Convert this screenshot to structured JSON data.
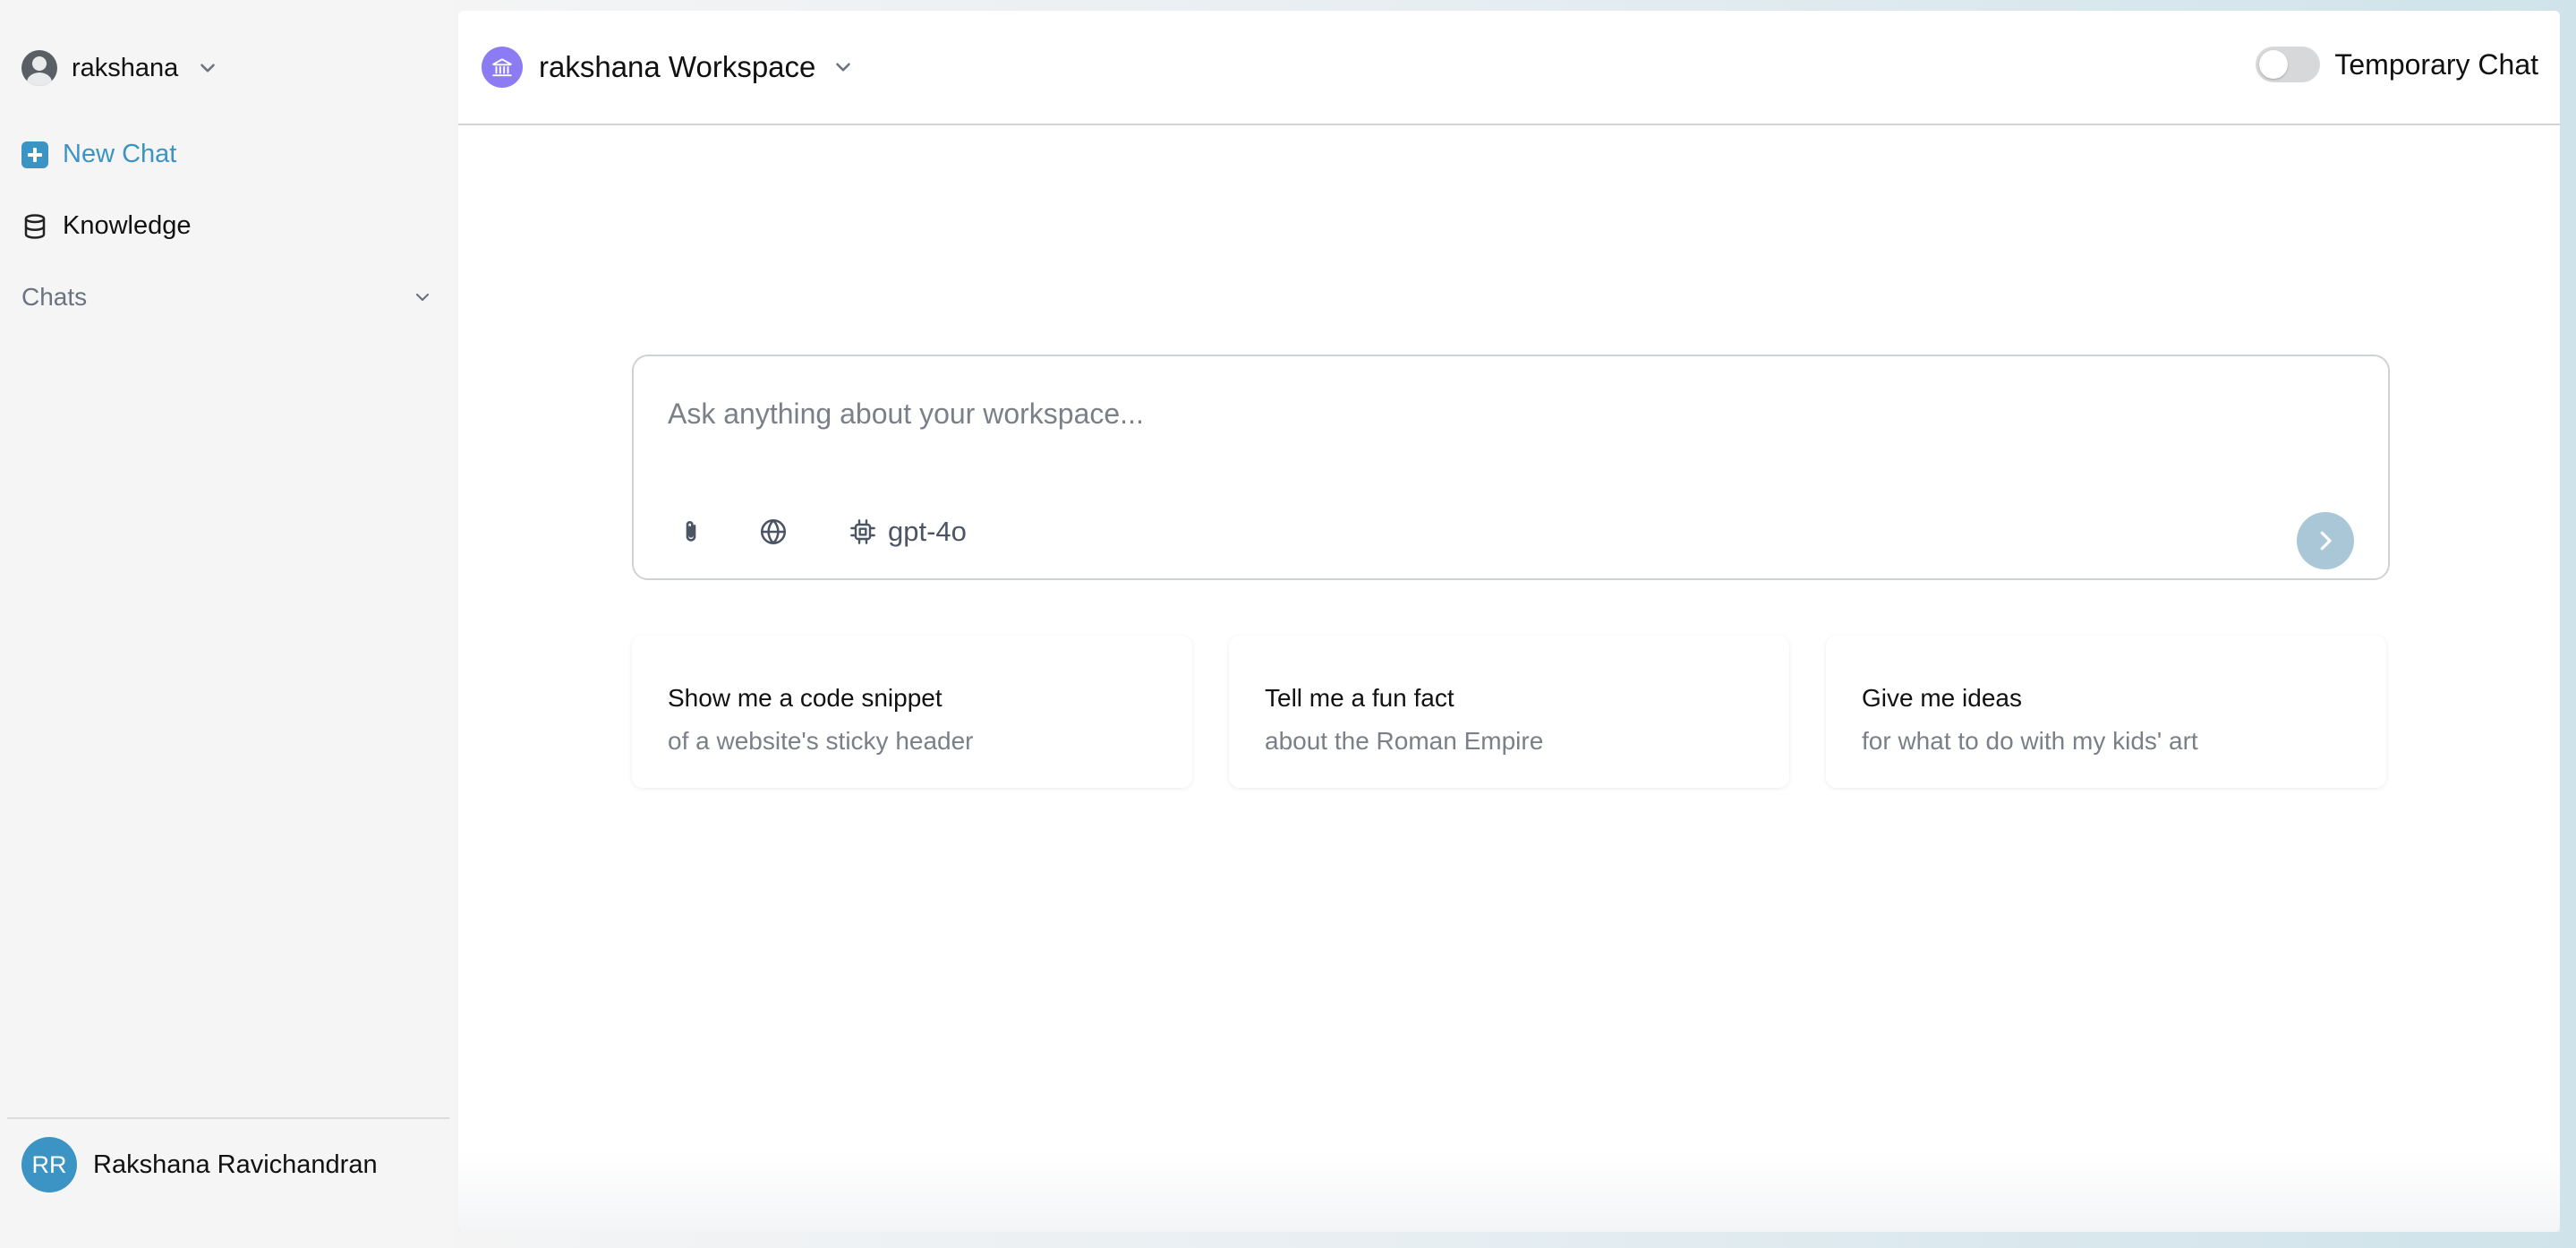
{
  "sidebar": {
    "user": {
      "name": "rakshana"
    },
    "new_chat": "New Chat",
    "knowledge": "Knowledge",
    "chats_label": "Chats",
    "profile": {
      "initials": "RR",
      "name": "Rakshana Ravichandran"
    }
  },
  "header": {
    "workspace_title": "rakshana Workspace",
    "temporary_chat_label": "Temporary Chat",
    "temporary_chat_enabled": false
  },
  "composer": {
    "placeholder": "Ask anything about your workspace...",
    "value": "",
    "model": "gpt-4o"
  },
  "suggestions": [
    {
      "title": "Show me a code snippet",
      "subtitle": "of a website's sticky header"
    },
    {
      "title": "Tell me a fun fact",
      "subtitle": "about the Roman Empire"
    },
    {
      "title": "Give me ideas",
      "subtitle": "for what to do with my kids' art"
    }
  ],
  "colors": {
    "accent": "#3b94c4",
    "workspace_icon": "#8b7cf3",
    "send_button": "#a9c7d6",
    "sidebar_bg": "#f5f5f5"
  },
  "icons": {
    "user_avatar": "user-avatar-icon",
    "new_chat": "plus-icon",
    "knowledge": "database-icon",
    "workspace": "bank-icon",
    "attach": "paperclip-icon",
    "web": "globe-icon",
    "model": "chip-icon",
    "send": "chevron-right-icon"
  }
}
